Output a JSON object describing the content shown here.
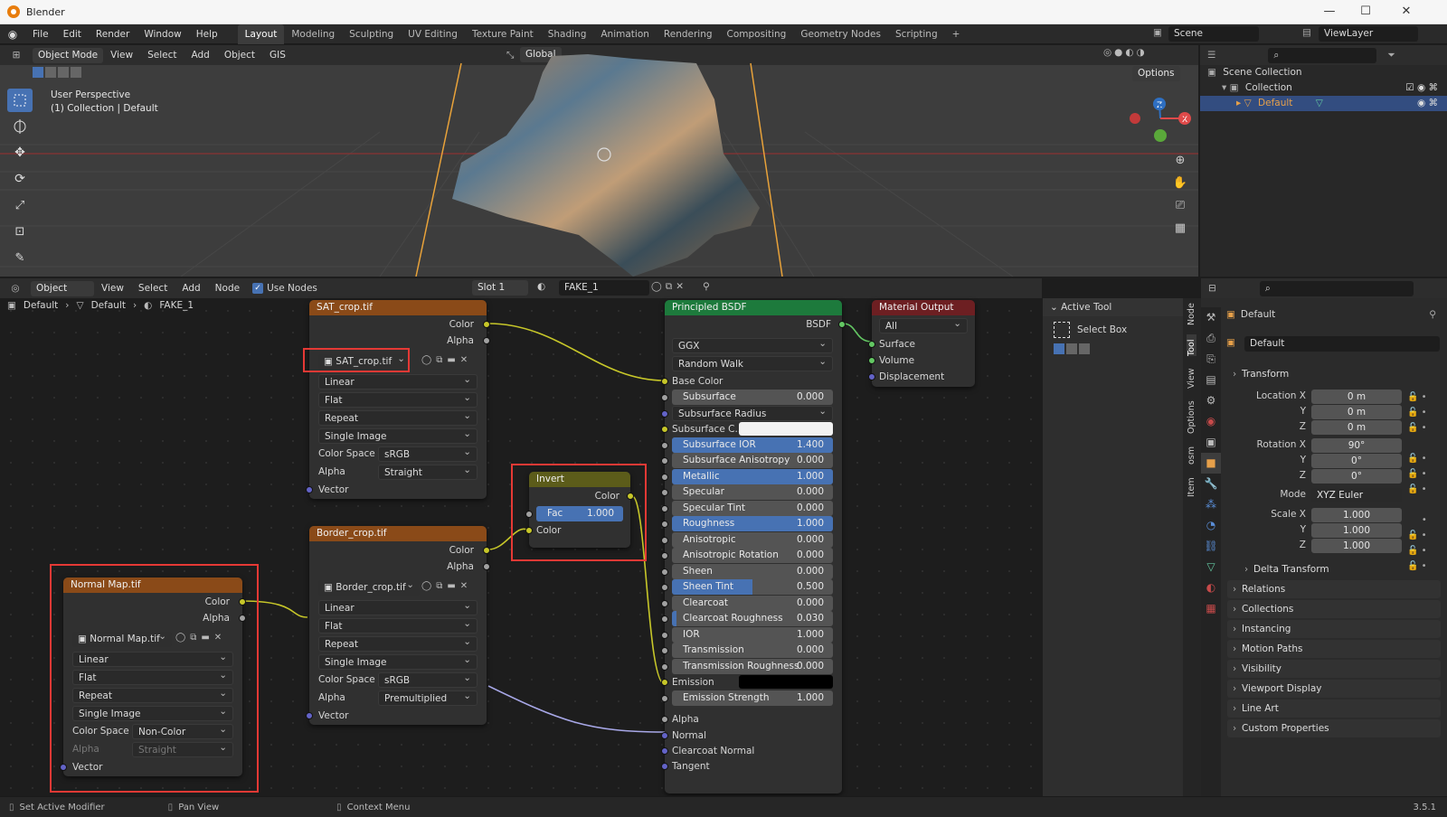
{
  "window": {
    "title": "Blender",
    "minimize": "—",
    "maximize": "☐",
    "close": "✕"
  },
  "menu": [
    "File",
    "Edit",
    "Render",
    "Window",
    "Help"
  ],
  "workspaces": [
    "Layout",
    "Modeling",
    "Sculpting",
    "UV Editing",
    "Texture Paint",
    "Shading",
    "Animation",
    "Rendering",
    "Compositing",
    "Geometry Nodes",
    "Scripting"
  ],
  "active_workspace": "Layout",
  "scene_name": "Scene",
  "view_layer": "ViewLayer",
  "viewport": {
    "mode": "Object Mode",
    "menus": [
      "View",
      "Select",
      "Add",
      "Object",
      "GIS"
    ],
    "orientation": "Global",
    "options": "Options",
    "overlay_line1": "User Perspective",
    "overlay_line2": "(1) Collection | Default"
  },
  "outliner": {
    "scene_collection": "Scene Collection",
    "collection": "Collection",
    "object": "Default"
  },
  "node_editor": {
    "mode": "Object",
    "menus": [
      "View",
      "Select",
      "Add",
      "Node"
    ],
    "use_nodes_label": "Use Nodes",
    "slot": "Slot 1",
    "material": "FAKE_1",
    "breadcrumb": [
      "Default",
      "Default",
      "FAKE_1"
    ]
  },
  "nodes": {
    "sat": {
      "title": "SAT_crop.tif",
      "out_color": "Color",
      "out_alpha": "Alpha",
      "image": "SAT_crop.tif",
      "interp": "Linear",
      "proj": "Flat",
      "ext": "Repeat",
      "source": "Single Image",
      "cs_label": "Color Space",
      "cs_value": "sRGB",
      "alpha_label": "Alpha",
      "alpha_value": "Straight",
      "in_vector": "Vector"
    },
    "border": {
      "title": "Border_crop.tif",
      "out_color": "Color",
      "out_alpha": "Alpha",
      "image": "Border_crop.tif",
      "interp": "Linear",
      "proj": "Flat",
      "ext": "Repeat",
      "source": "Single Image",
      "cs_label": "Color Space",
      "cs_value": "sRGB",
      "alpha_label": "Alpha",
      "alpha_value": "Premultiplied",
      "in_vector": "Vector"
    },
    "normal": {
      "title": "Normal Map.tif",
      "out_color": "Color",
      "out_alpha": "Alpha",
      "image": "Normal Map.tif",
      "interp": "Linear",
      "proj": "Flat",
      "ext": "Repeat",
      "source": "Single Image",
      "cs_label": "Color Space",
      "cs_value": "Non-Color",
      "alpha_label": "Alpha",
      "alpha_value": "Straight",
      "in_vector": "Vector"
    },
    "invert": {
      "title": "Invert",
      "out_color": "Color",
      "fac_label": "Fac",
      "fac_value": "1.000",
      "in_color": "Color"
    },
    "bsdf": {
      "title": "Principled BSDF",
      "out": "BSDF",
      "distribution": "GGX",
      "subsurface_method": "Random Walk",
      "base_color": "Base Color",
      "inputs": [
        {
          "label": "Subsurface",
          "value": "0.000",
          "fill": 0
        },
        {
          "label": "Subsurface Radius",
          "value": "",
          "fill": 0
        },
        {
          "label": "Subsurface C...",
          "value": "",
          "fill": 0
        },
        {
          "label": "Subsurface IOR",
          "value": "1.400",
          "fill": 1
        },
        {
          "label": "Subsurface Anisotropy",
          "value": "0.000",
          "fill": 0
        },
        {
          "label": "Metallic",
          "value": "1.000",
          "fill": 1
        },
        {
          "label": "Specular",
          "value": "0.000",
          "fill": 0
        },
        {
          "label": "Specular Tint",
          "value": "0.000",
          "fill": 0
        },
        {
          "label": "Roughness",
          "value": "1.000",
          "fill": 1
        },
        {
          "label": "Anisotropic",
          "value": "0.000",
          "fill": 0
        },
        {
          "label": "Anisotropic Rotation",
          "value": "0.000",
          "fill": 0
        },
        {
          "label": "Sheen",
          "value": "0.000",
          "fill": 0
        },
        {
          "label": "Sheen Tint",
          "value": "0.500",
          "fill": 0.5
        },
        {
          "label": "Clearcoat",
          "value": "0.000",
          "fill": 0
        },
        {
          "label": "Clearcoat Roughness",
          "value": "0.030",
          "fill": 0.03
        },
        {
          "label": "IOR",
          "value": "1.000",
          "fill": 0
        },
        {
          "label": "Transmission",
          "value": "0.000",
          "fill": 0
        },
        {
          "label": "Transmission Roughness",
          "value": "0.000",
          "fill": 0
        },
        {
          "label": "Emission",
          "value": "",
          "fill": 0
        },
        {
          "label": "Emission Strength",
          "value": "1.000",
          "fill": 0
        }
      ],
      "alpha": "Alpha",
      "normal": "Normal",
      "clearcoat_normal": "Clearcoat Normal",
      "tangent": "Tangent"
    },
    "output": {
      "title": "Material Output",
      "target": "All",
      "surface": "Surface",
      "volume": "Volume",
      "displacement": "Displacement"
    }
  },
  "active_tool": {
    "header": "Active Tool",
    "tool": "Select Box"
  },
  "side_tabs": [
    "Node",
    "Tool",
    "View",
    "Options",
    "osm",
    "Item"
  ],
  "properties": {
    "object_name": "Default",
    "data_name": "Default",
    "transform": "Transform",
    "location": {
      "label": "Location X",
      "x": "0 m",
      "y": "0 m",
      "z": "0 m"
    },
    "rotation": {
      "label": "Rotation X",
      "x": "90°",
      "y": "0°",
      "z": "0°"
    },
    "mode_label": "Mode",
    "mode_value": "XYZ Euler",
    "scale": {
      "label": "Scale X",
      "x": "1.000",
      "y": "1.000",
      "z": "1.000"
    },
    "delta": "Delta Transform",
    "panels": [
      "Relations",
      "Collections",
      "Instancing",
      "Motion Paths",
      "Visibility",
      "Viewport Display",
      "Line Art",
      "Custom Properties"
    ]
  },
  "status": {
    "left": "Set Active Modifier",
    "mid": "Pan View",
    "right": "Context Menu",
    "version": "3.5.1"
  },
  "colors": {
    "header_image": "#8a4a18",
    "header_shader": "#1d7a3c",
    "header_output": "#6d1f22",
    "header_invert": "#5c5c1a",
    "accent": "#4772b3",
    "highlight_box": "#e53935"
  }
}
